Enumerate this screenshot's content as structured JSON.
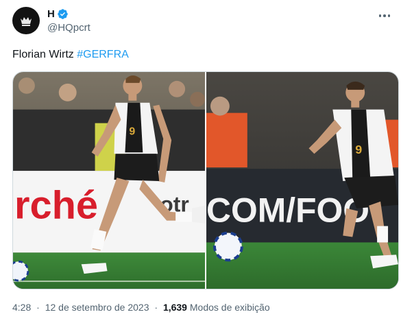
{
  "author": {
    "display_name": "H",
    "handle": "@HQpcrt",
    "verified": true
  },
  "tweet": {
    "text": "Florian Wirtz",
    "hashtag": "#GERFRA"
  },
  "media": [
    {
      "description": "football-player-running-photo-1",
      "ad_board_text": "rché",
      "ad_board_text_2": "otr"
    },
    {
      "description": "football-player-running-photo-2",
      "ad_board_text": "COM/FOO"
    }
  ],
  "meta": {
    "time": "4:28",
    "separator": "·",
    "date": "12 de setembro de 2023",
    "views_count": "1,639",
    "views_label": "Modos de exibição"
  },
  "colors": {
    "accent": "#1d9bf0",
    "text_primary": "#0f1419",
    "text_secondary": "#536471",
    "border": "#cfd9de"
  },
  "icons": [
    "avatar-logo-icon",
    "verified-badge-icon",
    "more-options-icon"
  ]
}
